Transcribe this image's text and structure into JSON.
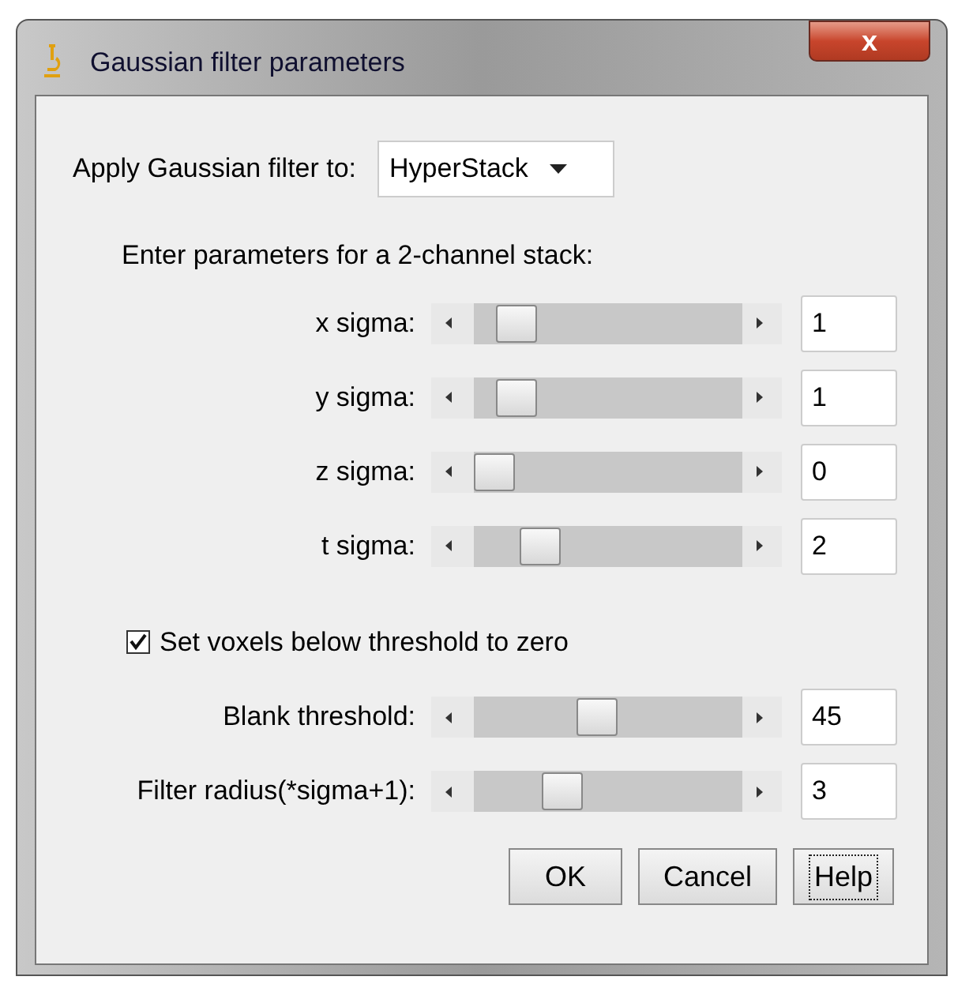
{
  "window": {
    "title": "Gaussian filter parameters",
    "close": "x"
  },
  "apply": {
    "label": "Apply Gaussian filter to:",
    "value": "HyperStack"
  },
  "heading": "Enter parameters for a 2-channel stack:",
  "sigmas": [
    {
      "label": "x sigma:",
      "level": 0.1,
      "value": "1"
    },
    {
      "label": "y sigma:",
      "level": 0.1,
      "value": "1"
    },
    {
      "label": "z sigma:",
      "level": 0,
      "value": "0"
    },
    {
      "label": "t sigma:",
      "level": 0.2,
      "value": "2"
    }
  ],
  "threshold_checkbox": {
    "label": "Set voxels below threshold to zero",
    "checked": true
  },
  "extra": [
    {
      "label": "Blank threshold:",
      "level": 0.45,
      "value": "45"
    },
    {
      "label": "Filter radius(*sigma+1):",
      "level": 0.3,
      "value": "3"
    }
  ],
  "buttons": [
    {
      "label": "OK",
      "focused": false
    },
    {
      "label": "Cancel",
      "focused": false
    },
    {
      "label": "Help",
      "focused": true
    }
  ]
}
